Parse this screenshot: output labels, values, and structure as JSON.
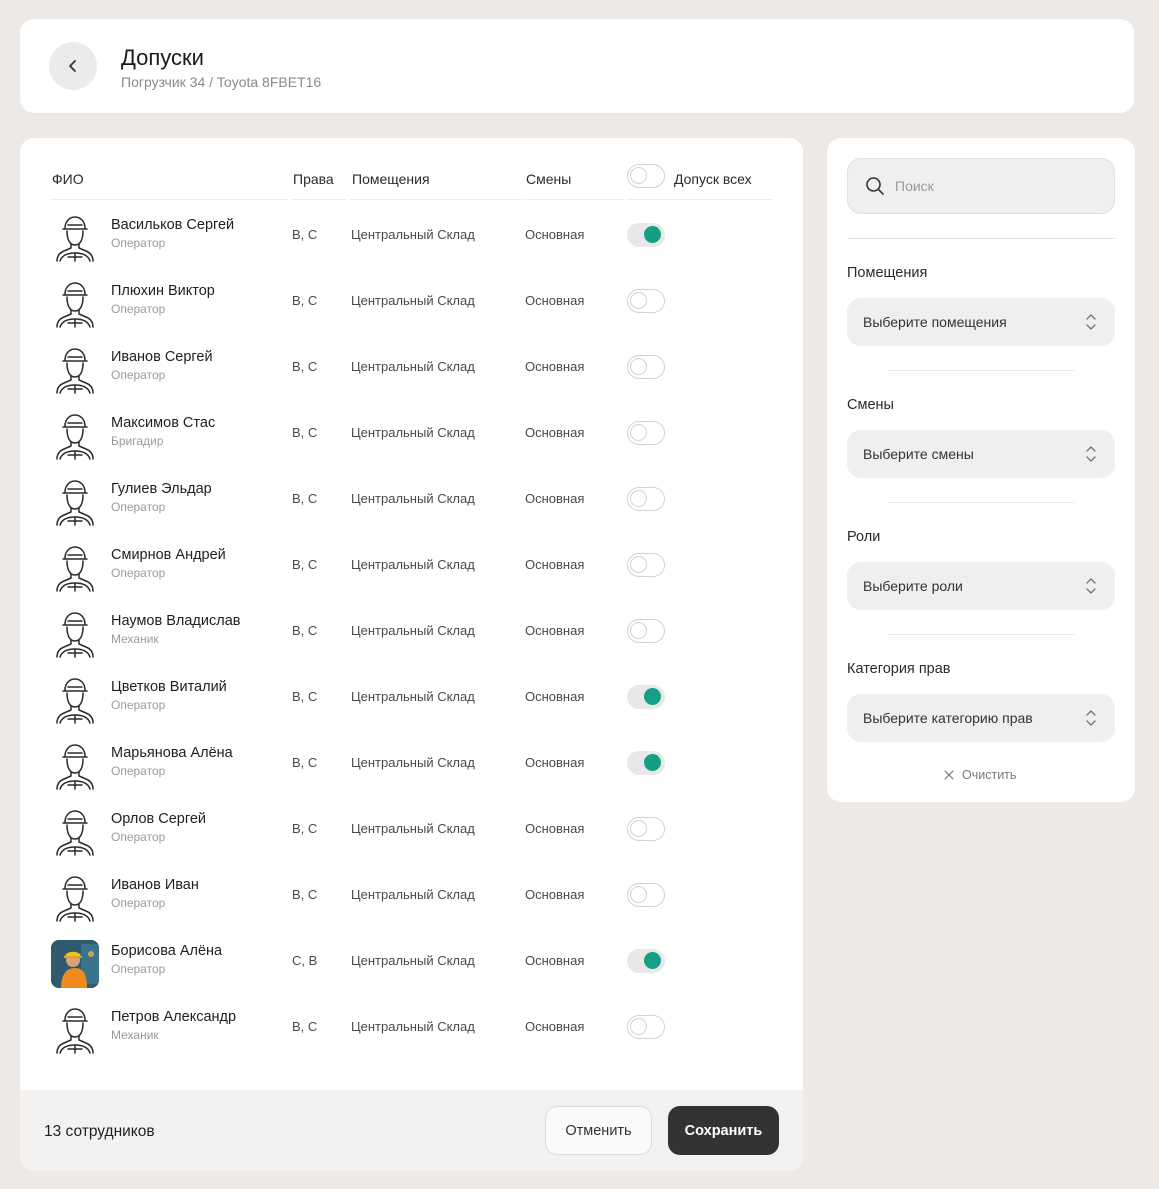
{
  "header": {
    "title": "Допуски",
    "subtitle": "Погрузчик 34 / Toyota 8FBET16"
  },
  "table": {
    "columns": {
      "name": "ФИО",
      "rights": "Права",
      "rooms": "Помещения",
      "shifts": "Смены",
      "allow_all": "Допуск всех"
    },
    "allow_all_on": false,
    "rows": [
      {
        "name": "Васильков Сергей",
        "role": "Оператор",
        "rights": "B, C",
        "room": "Центральный Склад",
        "shift": "Основная",
        "allowed": true,
        "photo": false
      },
      {
        "name": "Плюхин Виктор",
        "role": "Оператор",
        "rights": "B, C",
        "room": "Центральный Склад",
        "shift": "Основная",
        "allowed": false,
        "photo": false
      },
      {
        "name": "Иванов Сергей",
        "role": "Оператор",
        "rights": "B, C",
        "room": "Центральный Склад",
        "shift": "Основная",
        "allowed": false,
        "photo": false
      },
      {
        "name": "Максимов Стас",
        "role": "Бригадир",
        "rights": "B, C",
        "room": "Центральный Склад",
        "shift": "Основная",
        "allowed": false,
        "photo": false
      },
      {
        "name": "Гулиев Эльдар",
        "role": "Оператор",
        "rights": "B, C",
        "room": "Центральный Склад",
        "shift": "Основная",
        "allowed": false,
        "photo": false
      },
      {
        "name": "Смирнов Андрей",
        "role": "Оператор",
        "rights": "B, C",
        "room": "Центральный Склад",
        "shift": "Основная",
        "allowed": false,
        "photo": false
      },
      {
        "name": "Наумов Владислав",
        "role": "Механик",
        "rights": "B, C",
        "room": "Центральный Склад",
        "shift": "Основная",
        "allowed": false,
        "photo": false
      },
      {
        "name": "Цветков Виталий",
        "role": "Оператор",
        "rights": "B, C",
        "room": "Центральный Склад",
        "shift": "Основная",
        "allowed": true,
        "photo": false
      },
      {
        "name": "Марьянова Алёна",
        "role": "Оператор",
        "rights": "B, C",
        "room": "Центральный Склад",
        "shift": "Основная",
        "allowed": true,
        "photo": false
      },
      {
        "name": "Орлов Сергей",
        "role": "Оператор",
        "rights": "B, C",
        "room": "Центральный Склад",
        "shift": "Основная",
        "allowed": false,
        "photo": false
      },
      {
        "name": "Иванов Иван",
        "role": "Оператор",
        "rights": "B, C",
        "room": "Центральный Склад",
        "shift": "Основная",
        "allowed": false,
        "photo": false
      },
      {
        "name": "Борисова Алёна",
        "role": "Оператор",
        "rights": "C, B",
        "room": "Центральный Склад",
        "shift": "Основная",
        "allowed": true,
        "photo": true
      },
      {
        "name": "Петров Александр",
        "role": "Механик",
        "rights": "B, C",
        "room": "Центральный Склад",
        "shift": "Основная",
        "allowed": false,
        "photo": false
      }
    ]
  },
  "footer": {
    "count": "13 сотрудников",
    "cancel": "Отменить",
    "save": "Сохранить"
  },
  "filters": {
    "search_placeholder": "Поиск",
    "rooms_label": "Помещения",
    "rooms_value": "Выберите помещения",
    "shifts_label": "Смены",
    "shifts_value": "Выберите смены",
    "roles_label": "Роли",
    "roles_value": "Выберите роли",
    "category_label": "Категория прав",
    "category_value": "Выберите категорию прав",
    "clear": "Очистить"
  },
  "colors": {
    "toggle_on": "#15a085",
    "save_button": "#333333",
    "background": "#ece9e7"
  },
  "icons": [
    "chevron-left-icon",
    "worker-avatar-icon",
    "search-icon",
    "chevron-up-down-icon",
    "close-icon"
  ]
}
